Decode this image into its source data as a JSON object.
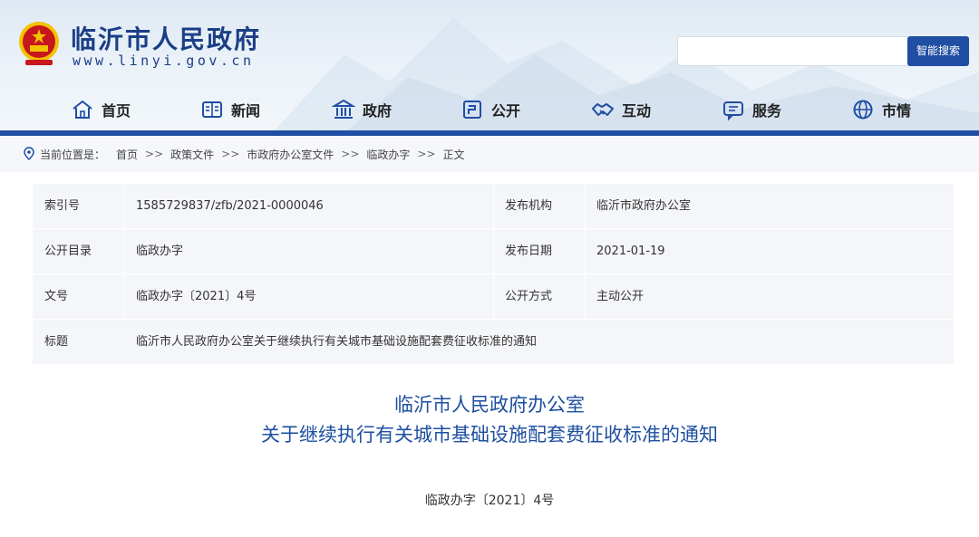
{
  "header": {
    "site_name": "临沂市人民政府",
    "site_url": "www.linyi.gov.cn",
    "search_placeholder": "",
    "search_button": "智能搜索"
  },
  "nav": [
    {
      "label": "首页",
      "icon": "home-icon"
    },
    {
      "label": "新闻",
      "icon": "newspaper-icon"
    },
    {
      "label": "政府",
      "icon": "government-building-icon"
    },
    {
      "label": "公开",
      "icon": "open-document-icon"
    },
    {
      "label": "互动",
      "icon": "handshake-icon"
    },
    {
      "label": "服务",
      "icon": "service-chat-icon"
    },
    {
      "label": "市情",
      "icon": "globe-icon"
    }
  ],
  "breadcrumb": {
    "prefix": "当前位置是：",
    "items": [
      "首页",
      "政策文件",
      "市政府办公室文件",
      "临政办字",
      "正文"
    ],
    "separator": ">>"
  },
  "meta": {
    "rows": [
      {
        "k1": "索引号",
        "v1": "1585729837/zfb/2021-0000046",
        "k2": "发布机构",
        "v2": "临沂市政府办公室"
      },
      {
        "k1": "公开目录",
        "v1": "临政办字",
        "k2": "发布日期",
        "v2": "2021-01-19"
      },
      {
        "k1": "文号",
        "v1": "临政办字〔2021〕4号",
        "k2": "公开方式",
        "v2": "主动公开"
      },
      {
        "k1": "标题",
        "v1": "临沂市人民政府办公室关于继续执行有关城市基础设施配套费征收标准的通知"
      }
    ]
  },
  "document": {
    "title_line1": "临沂市人民政府办公室",
    "title_line2": "关于继续执行有关城市基础设施配套费征收标准的通知",
    "number": "临政办字〔2021〕4号"
  },
  "colors": {
    "primary_blue": "#1f4ea3",
    "title_blue": "#1e4fa1",
    "emblem_red": "#c8161d",
    "emblem_gold": "#f2c300"
  }
}
